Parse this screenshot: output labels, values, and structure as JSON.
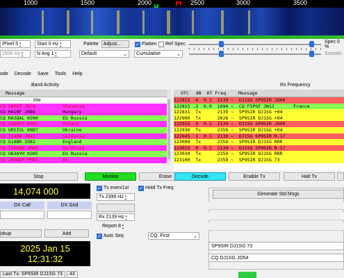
{
  "waterfall": {
    "scale_labels": [
      "1000",
      "1500",
      "2000",
      "2500",
      "3000",
      "3500"
    ]
  },
  "controls": {
    "bins_per_pixel": {
      "label": "/Pixel",
      "value": "5"
    },
    "start": {
      "label": "Start",
      "value": "0 Hz"
    },
    "palette": {
      "label": "Palette",
      "button": "Adjust..."
    },
    "flatten": {
      "label": "Flatten",
      "checked": true
    },
    "ref_spec": {
      "label": "Ref Spec",
      "checked": false
    },
    "spec": {
      "label": "Spec 0 %"
    },
    "hz_value": "2500",
    "hz_unit": "Hz",
    "n_avg": "N Avg 1",
    "palette_select": "Default",
    "spectrum_select": "Cumulative",
    "smooth": "Smooth",
    "colors": {
      "accent": "#2c6fd1"
    }
  },
  "menu": {
    "items": [
      "ode",
      "Decode",
      "Save",
      "Tools",
      "Help"
    ]
  },
  "band_activity": {
    "title": "Band Activity",
    "header": "Message",
    "rows": [
      {
        "text": "----------- 20m",
        "bg": "#ffffff"
      },
      {
        "text": "CQ 9A0PZ JN76          Slovenia",
        "bg": "#ff33ff"
      },
      {
        "text": "CQ HA1BF JN86          Hungary",
        "bg": "#ff33ff"
      },
      {
        "text": "CQ RA3QAL KO90         EU Russia",
        "bg": "#88ff55"
      },
      {
        "text": "CQ SQ8BFO KO02         Poland",
        "bg": "#ff33ff"
      },
      {
        "text": "CQ UR5IVL KN87         Ukraine",
        "bg": "#88ff55"
      },
      {
        "text": "CQ IS4DW JN41          Sardinia",
        "bg": "#ff33ff"
      },
      {
        "text": "CQ G1ABR IO82          England",
        "bg": "#88ff55"
      },
      {
        "text": "CQ IS0HAN JM49         Sardinia",
        "bg": "#ff33ff"
      },
      {
        "text": "CQ UB3AYH KO85         EU Russia",
        "bg": "#88ff55"
      },
      {
        "text": "CQ JM4WQP PM85         AS",
        "bg": "#ff33ff"
      }
    ]
  },
  "rx_frequency": {
    "title": "Rx Frequency",
    "headers": [
      "UTC",
      "dB",
      "DT",
      "Freq",
      "Message"
    ],
    "rows": [
      {
        "text": "122815  4  0.1  2139 ~  DJ1SG SP9SIR JO90",
        "bg": "#ff5f5f"
      },
      {
        "text": "122815 -3  0.0  1894 ~  CQ F5PGF JN12       France",
        "bg": "#88ff55"
      },
      {
        "text": "122831  Tx      2139 ~  SP9SIR DJ1SG +04",
        "bg": "#ffff33"
      },
      {
        "text": "122900  Tx      2028 ~  SP9SIR DJ1SG +04",
        "bg": "#ffff33"
      },
      {
        "text": "122915  0  0.1  2139 ~  DJ1SG SP9SIR JO90",
        "bg": "#ff5f5f"
      },
      {
        "text": "122930  Tx      2359 ~  SP9SIR DJ1SG +04",
        "bg": "#ffff33"
      },
      {
        "text": "122945  1  0.1  2139 ~  DJ1SG SP9SIR R-17",
        "bg": "#ff5f5f"
      },
      {
        "text": "123000  Tx      2359 ~  SP9SIR DJ1SG RRR",
        "bg": "#ffff33"
      },
      {
        "text": "123015  8  0.1  2139 ~  DJ1SG SP9SIR R-17",
        "bg": "#ff5f5f"
      },
      {
        "text": "123030  Tx      2359 ~  SP9SIR DJ1SG RRR",
        "bg": "#ffff33"
      },
      {
        "text": "123100  Tx      2359 ~  SP9SIR DJ1SG 73",
        "bg": "#ffff33"
      }
    ]
  },
  "buttons": {
    "stop": "Stop",
    "monitor": "Monitor",
    "erase": "Erase",
    "decode": "Decode",
    "enable_tx": "Enable Tx",
    "halt_tx": "Halt Tx"
  },
  "lower": {
    "dial_freq": "14,074 000",
    "dx_call": "DX Call",
    "dx_grid": "DX Grid",
    "lookup": "okup",
    "add": "Add",
    "date": "2025 Jan 15",
    "time": "12:31:32",
    "tx_even": {
      "label": "Tx even/1st",
      "checked": true
    },
    "hold_tx": {
      "label": "Hold Tx Freq",
      "checked": true
    },
    "tx_freq": {
      "label": "Tx",
      "value": "2399",
      "unit": "Hz"
    },
    "rx_freq": {
      "label": "Rx",
      "value": "2139",
      "unit": "Hz"
    },
    "report": "Report 8",
    "auto_seq": {
      "label": "Auto Seq",
      "checked": true
    },
    "cq_select": "CQ: First",
    "generate": "Generate Std Msgs",
    "tx_msg1": "SP9SIR DJ1SG 73",
    "tx_msg2": "CQ DJ1SG JO54"
  },
  "status": {
    "last_tx": "Last Tx: SP9SIR DJ1SG 73",
    "counter": "43"
  }
}
